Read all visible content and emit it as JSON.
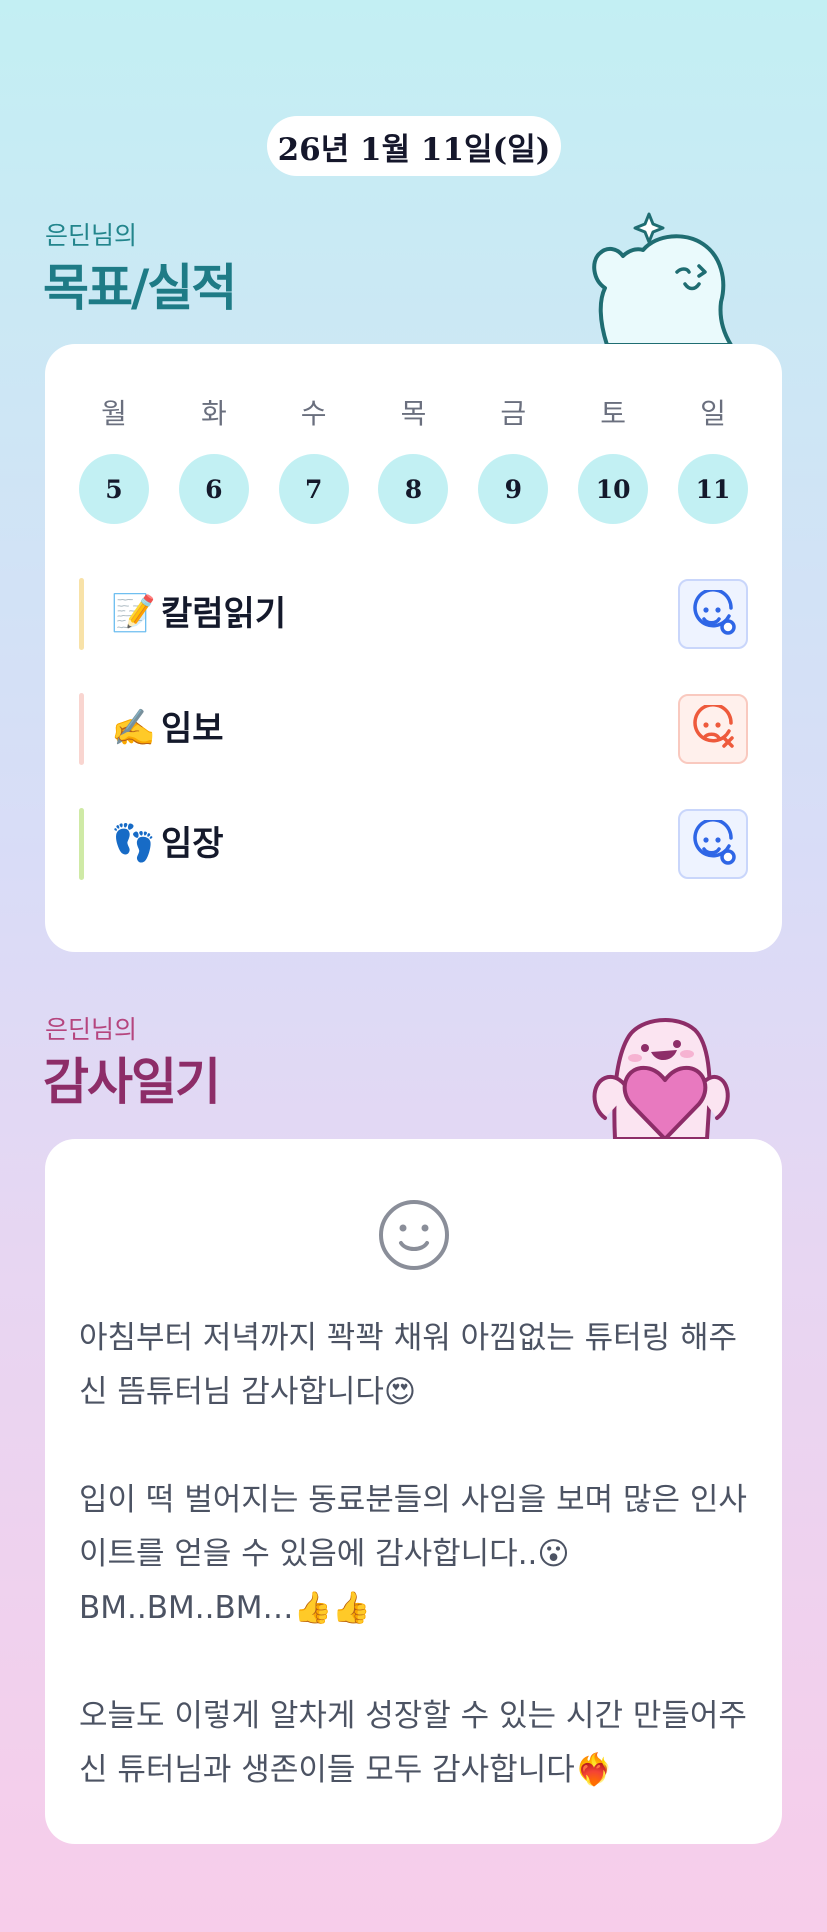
{
  "date": "26년 1월 11일(일)",
  "goal_section": {
    "subtitle": "은딘님의",
    "title": "목표/실적",
    "days": [
      {
        "name": "월",
        "num": "5"
      },
      {
        "name": "화",
        "num": "6"
      },
      {
        "name": "수",
        "num": "7"
      },
      {
        "name": "목",
        "num": "8"
      },
      {
        "name": "금",
        "num": "9"
      },
      {
        "name": "토",
        "num": "10"
      },
      {
        "name": "일",
        "num": "11"
      }
    ],
    "goals": [
      {
        "emoji": "📝",
        "label": "칼럼읽기",
        "status": "done",
        "bar_color": "#f8e2a8",
        "icon": "smile-check-icon"
      },
      {
        "emoji": "✍️",
        "label": "임보",
        "status": "fail",
        "bar_color": "#f9d5d0",
        "icon": "sad-x-icon"
      },
      {
        "emoji": "👣",
        "label": "임장",
        "status": "done",
        "bar_color": "#cfeaa6",
        "icon": "smile-check-icon"
      }
    ],
    "colors": {
      "done": "#2f66e6",
      "fail": "#ee5a3c",
      "day_circle": "#c2f0f3"
    }
  },
  "thanks_section": {
    "subtitle": "은딘님의",
    "title": "감사일기",
    "mood_icon": "smile-face-icon",
    "text": "아침부터 저녁까지 꽉꽉 채워 아낌없는 튜터링 해주신 뜸튜터님 감사합니다😍\n\n입이 떡 벌어지는 동료분들의 사임을 보며 많은 인사이트를 얻을 수 있음에 감사합니다..😮\nBM..BM..BM…👍👍\n\n오늘도 이렇게 알차게 성장할 수 있는 시간 만들어주신 튜터님과 생존이들 모두 감사합니다❤️‍🔥"
  }
}
